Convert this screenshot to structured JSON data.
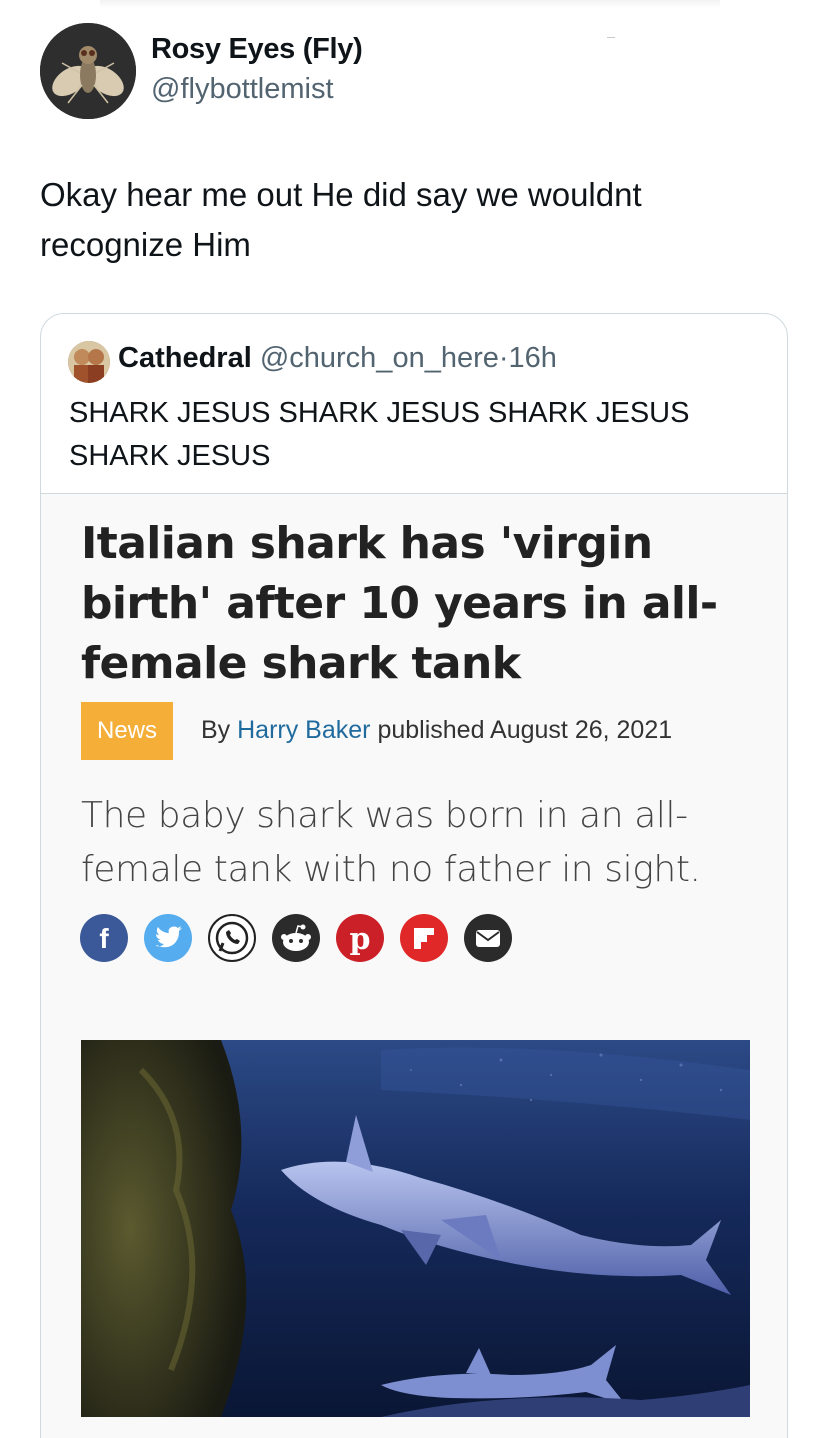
{
  "tweet": {
    "author_name": "Rosy Eyes (Fly)",
    "author_handle": "@flybottlemist",
    "text": "Okay hear me out He did say we wouldnt recognize Him"
  },
  "quoted_tweet": {
    "author_name": "Cathedral",
    "author_handle": "@church_on_here",
    "separator": "·",
    "time": "16h",
    "text": "SHARK JESUS SHARK JESUS SHARK JESUS SHARK JESUS"
  },
  "article": {
    "title": "Italian shark has 'virgin birth' after 10 years in all-female shark tank",
    "category_badge": "News",
    "byline_prefix": "By ",
    "byline_author": "Harry Baker",
    "byline_published": " published August 26, 2021",
    "subtitle": "The baby shark was born in an all-female tank with no father in sight.",
    "share_icons": [
      "facebook-icon",
      "twitter-icon",
      "whatsapp-icon",
      "reddit-icon",
      "pinterest-icon",
      "flipboard-icon",
      "email-icon"
    ]
  },
  "colors": {
    "handle_gray": "#536471",
    "border": "#cfd9de",
    "badge_orange": "#f5ae37",
    "link_blue": "#1f6b9e",
    "facebook": "#3b5998",
    "twitter": "#55acee",
    "pinterest": "#cb2027",
    "flipboard": "#e12828"
  }
}
